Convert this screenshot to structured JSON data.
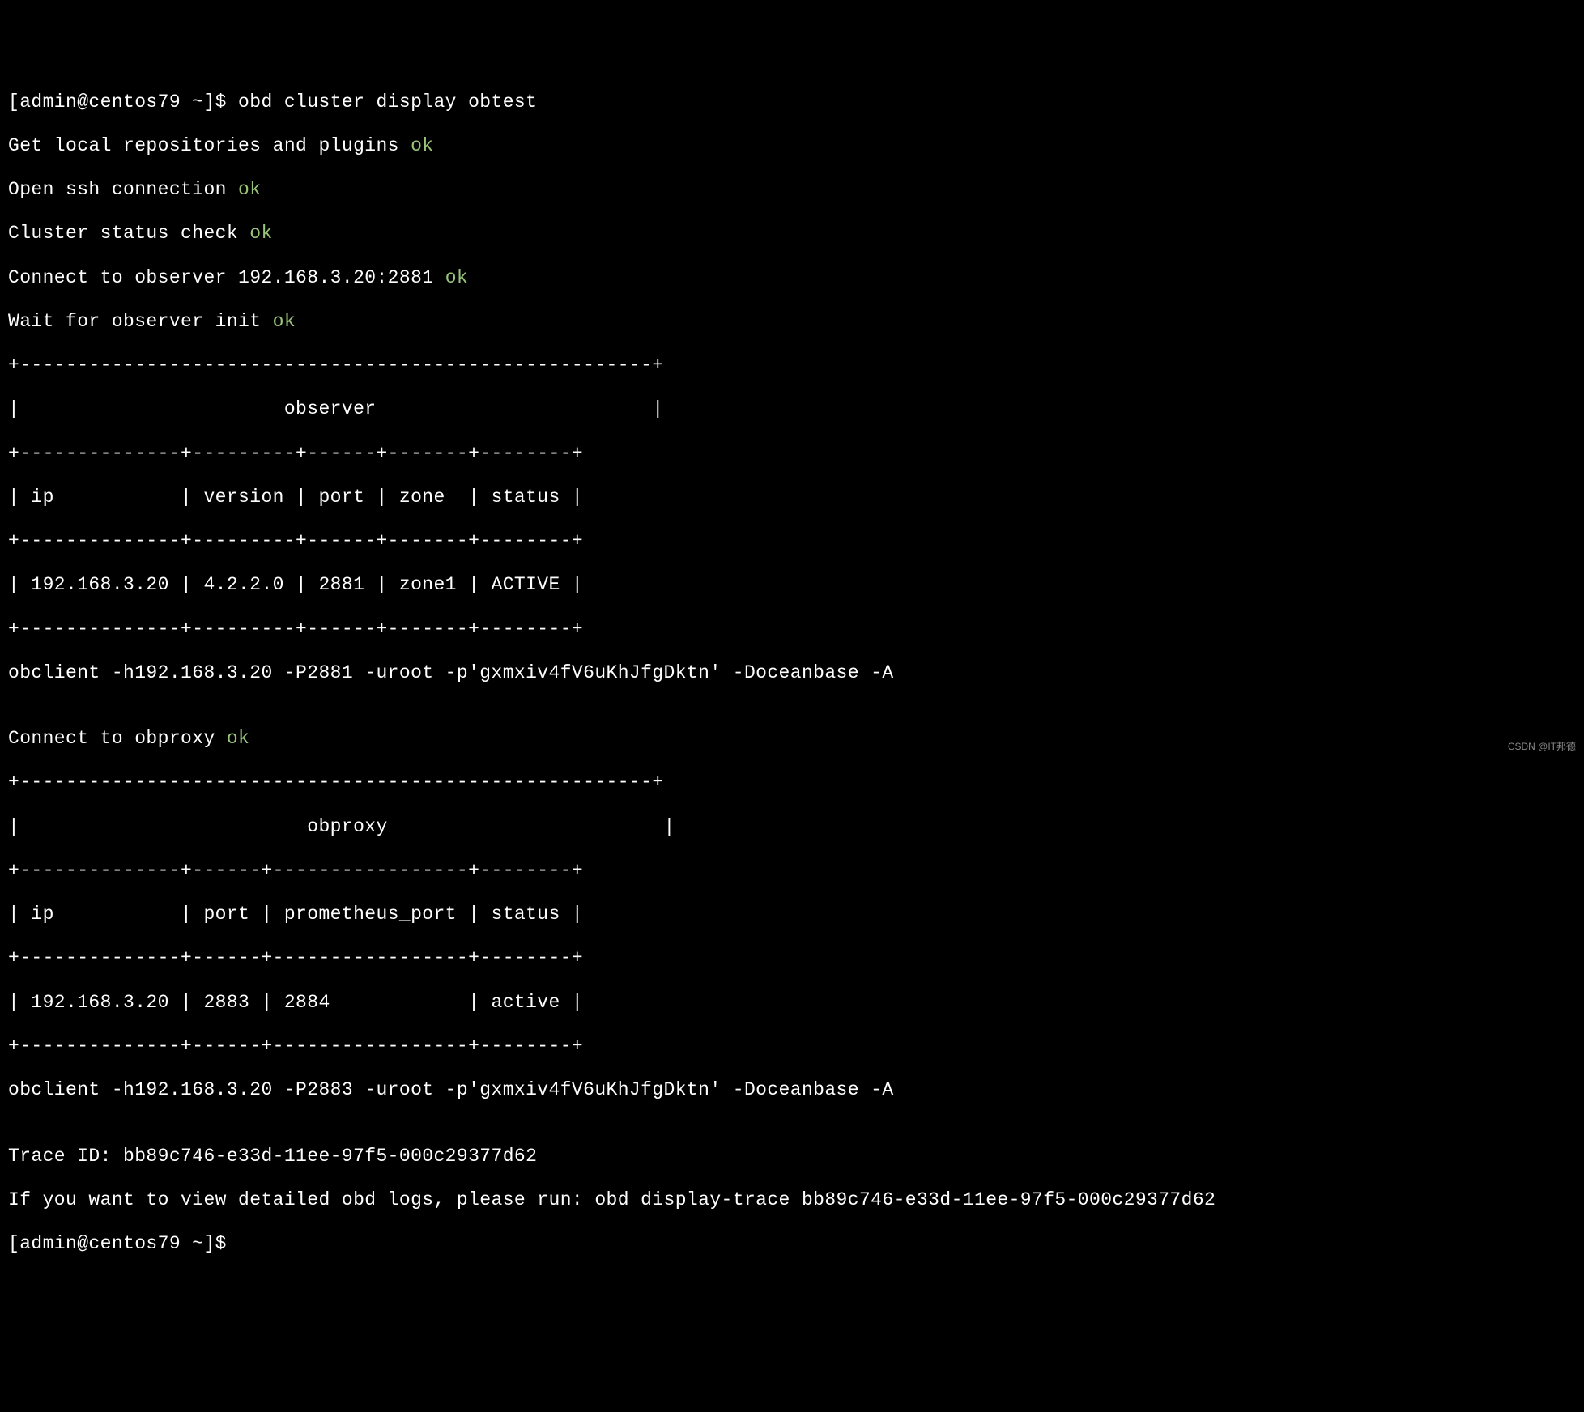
{
  "terminal": {
    "prompt1": "[admin@centos79 ~]$ ",
    "command": "obd cluster display obtest",
    "step1_text": "Get local repositories and plugins ",
    "step1_status": "ok",
    "step2_text": "Open ssh connection ",
    "step2_status": "ok",
    "step3_text": "Cluster status check ",
    "step3_status": "ok",
    "step4_text": "Connect to observer 192.168.3.20:2881 ",
    "step4_status": "ok",
    "step5_text": "Wait for observer init ",
    "step5_status": "ok",
    "observer_table": {
      "border_top": "+-------------------------------------------------------+",
      "title": "|                       observer                        |",
      "header_border": "+--------------+---------+------+-------+--------+",
      "header": "| ip           | version | port | zone  | status |",
      "row_border": "+--------------+---------+------+-------+--------+",
      "row1": "| 192.168.3.20 | 4.2.2.0 | 2881 | zone1 | ACTIVE |",
      "bottom_border": "+--------------+---------+------+-------+--------+"
    },
    "obclient1": "obclient -h192.168.3.20 -P2881 -uroot -p'gxmxiv4fV6uKhJfgDktn' -Doceanbase -A",
    "blank1": "",
    "step6_text": "Connect to obproxy ",
    "step6_status": "ok",
    "obproxy_table": {
      "border_top": "+-------------------------------------------------------+",
      "title": "|                         obproxy                        |",
      "header_border": "+--------------+------+-----------------+--------+",
      "header": "| ip           | port | prometheus_port | status |",
      "row_border": "+--------------+------+-----------------+--------+",
      "row1": "| 192.168.3.20 | 2883 | 2884            | active |",
      "bottom_border": "+--------------+------+-----------------+--------+"
    },
    "obclient2": "obclient -h192.168.3.20 -P2883 -uroot -p'gxmxiv4fV6uKhJfgDktn' -Doceanbase -A",
    "blank2": "",
    "trace_id": "Trace ID: bb89c746-e33d-11ee-97f5-000c29377d62",
    "trace_hint": "If you want to view detailed obd logs, please run: obd display-trace bb89c746-e33d-11ee-97f5-000c29377d62",
    "prompt2": "[admin@centos79 ~]$ "
  },
  "watermark": "CSDN @IT邦德"
}
